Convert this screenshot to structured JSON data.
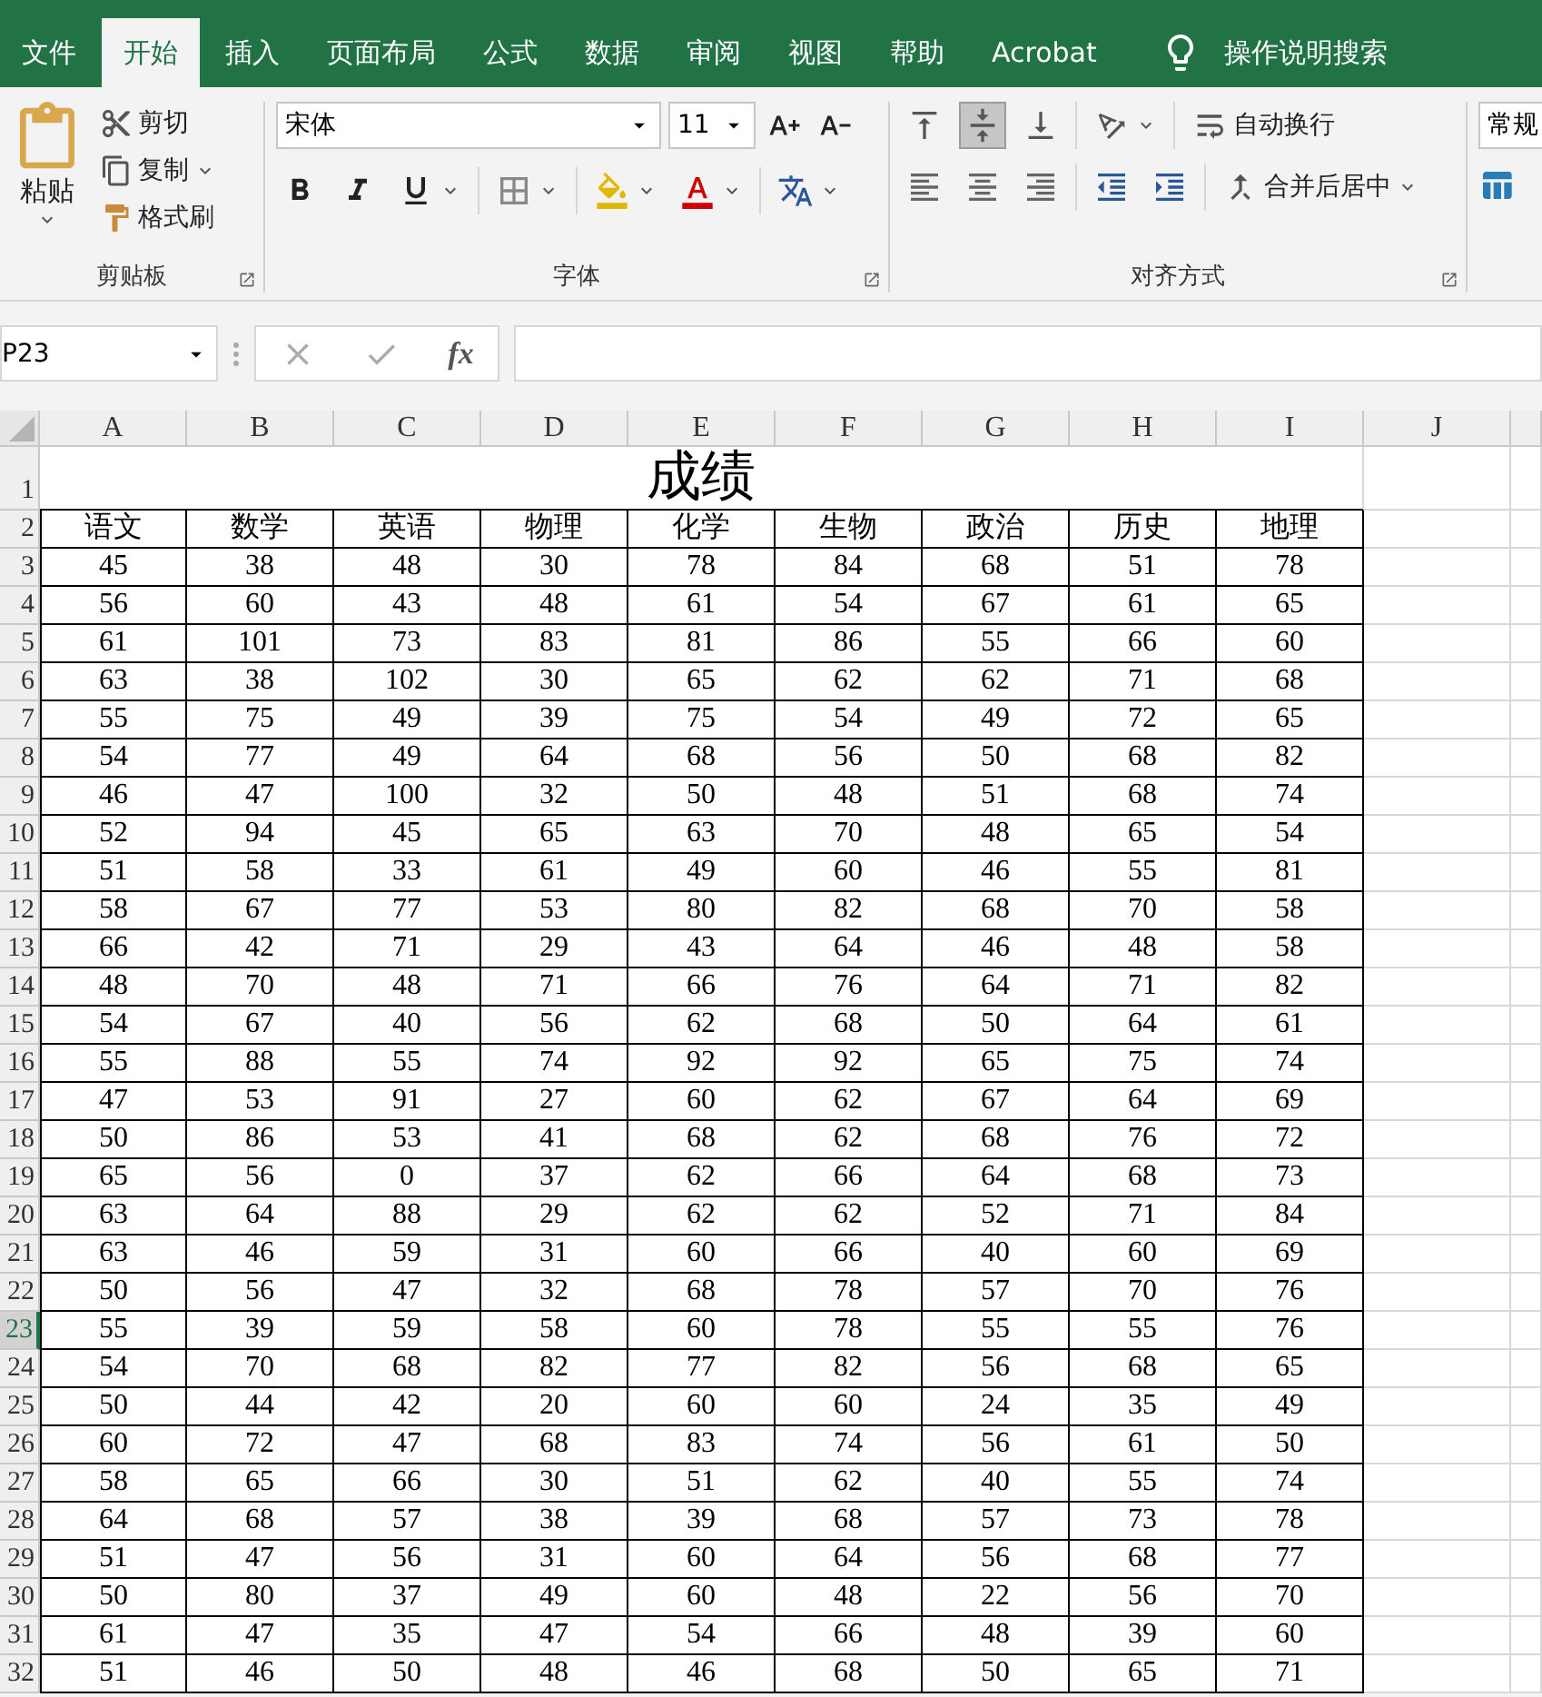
{
  "tabs": [
    {
      "label": "文件",
      "selected": false
    },
    {
      "label": "开始",
      "selected": true
    },
    {
      "label": "插入",
      "selected": false
    },
    {
      "label": "页面布局",
      "selected": false
    },
    {
      "label": "公式",
      "selected": false
    },
    {
      "label": "数据",
      "selected": false
    },
    {
      "label": "审阅",
      "selected": false
    },
    {
      "label": "视图",
      "selected": false
    },
    {
      "label": "帮助",
      "selected": false
    },
    {
      "label": "Acrobat",
      "selected": false
    }
  ],
  "tell_me": {
    "label": "操作说明搜索"
  },
  "ribbon": {
    "clipboard": {
      "title": "剪贴板",
      "paste": "粘贴",
      "cut": "剪切",
      "copy": "复制",
      "format_painter": "格式刷"
    },
    "font": {
      "title": "字体",
      "font_name": "宋体",
      "font_size": "11"
    },
    "alignment": {
      "title": "对齐方式",
      "vertical": [
        {
          "kind": "top",
          "selected": false
        },
        {
          "kind": "middle",
          "selected": true
        },
        {
          "kind": "bottom",
          "selected": false
        }
      ],
      "wrap_text": "自动换行",
      "merge_center": "合并后居中"
    },
    "number": {
      "format": "常规"
    }
  },
  "formula_bar": {
    "name_box": "P23",
    "fx": "fx"
  },
  "sheet": {
    "columns": [
      {
        "label": "A",
        "selected": false
      },
      {
        "label": "B",
        "selected": false
      },
      {
        "label": "C",
        "selected": false
      },
      {
        "label": "D",
        "selected": false
      },
      {
        "label": "E",
        "selected": false
      },
      {
        "label": "F",
        "selected": false
      },
      {
        "label": "G",
        "selected": false
      },
      {
        "label": "H",
        "selected": false
      },
      {
        "label": "I",
        "selected": false
      },
      {
        "label": "J",
        "selected": false
      }
    ],
    "title_row": {
      "header": "1",
      "text": "成绩"
    },
    "header_row": {
      "header": "2",
      "cells": [
        "语文",
        "数学",
        "英语",
        "物理",
        "化学",
        "生物",
        "政治",
        "历史",
        "地理"
      ]
    },
    "rows": [
      {
        "header": "3",
        "selected": false,
        "cells": [
          "45",
          "38",
          "48",
          "30",
          "78",
          "84",
          "68",
          "51",
          "78"
        ]
      },
      {
        "header": "4",
        "selected": false,
        "cells": [
          "56",
          "60",
          "43",
          "48",
          "61",
          "54",
          "67",
          "61",
          "65"
        ]
      },
      {
        "header": "5",
        "selected": false,
        "cells": [
          "61",
          "101",
          "73",
          "83",
          "81",
          "86",
          "55",
          "66",
          "60"
        ]
      },
      {
        "header": "6",
        "selected": false,
        "cells": [
          "63",
          "38",
          "102",
          "30",
          "65",
          "62",
          "62",
          "71",
          "68"
        ]
      },
      {
        "header": "7",
        "selected": false,
        "cells": [
          "55",
          "75",
          "49",
          "39",
          "75",
          "54",
          "49",
          "72",
          "65"
        ]
      },
      {
        "header": "8",
        "selected": false,
        "cells": [
          "54",
          "77",
          "49",
          "64",
          "68",
          "56",
          "50",
          "68",
          "82"
        ]
      },
      {
        "header": "9",
        "selected": false,
        "cells": [
          "46",
          "47",
          "100",
          "32",
          "50",
          "48",
          "51",
          "68",
          "74"
        ]
      },
      {
        "header": "10",
        "selected": false,
        "cells": [
          "52",
          "94",
          "45",
          "65",
          "63",
          "70",
          "48",
          "65",
          "54"
        ]
      },
      {
        "header": "11",
        "selected": false,
        "cells": [
          "51",
          "58",
          "33",
          "61",
          "49",
          "60",
          "46",
          "55",
          "81"
        ]
      },
      {
        "header": "12",
        "selected": false,
        "cells": [
          "58",
          "67",
          "77",
          "53",
          "80",
          "82",
          "68",
          "70",
          "58"
        ]
      },
      {
        "header": "13",
        "selected": false,
        "cells": [
          "66",
          "42",
          "71",
          "29",
          "43",
          "64",
          "46",
          "48",
          "58"
        ]
      },
      {
        "header": "14",
        "selected": false,
        "cells": [
          "48",
          "70",
          "48",
          "71",
          "66",
          "76",
          "64",
          "71",
          "82"
        ]
      },
      {
        "header": "15",
        "selected": false,
        "cells": [
          "54",
          "67",
          "40",
          "56",
          "62",
          "68",
          "50",
          "64",
          "61"
        ]
      },
      {
        "header": "16",
        "selected": false,
        "cells": [
          "55",
          "88",
          "55",
          "74",
          "92",
          "92",
          "65",
          "75",
          "74"
        ]
      },
      {
        "header": "17",
        "selected": false,
        "cells": [
          "47",
          "53",
          "91",
          "27",
          "60",
          "62",
          "67",
          "64",
          "69"
        ]
      },
      {
        "header": "18",
        "selected": false,
        "cells": [
          "50",
          "86",
          "53",
          "41",
          "68",
          "62",
          "68",
          "76",
          "72"
        ]
      },
      {
        "header": "19",
        "selected": false,
        "cells": [
          "65",
          "56",
          "0",
          "37",
          "62",
          "66",
          "64",
          "68",
          "73"
        ]
      },
      {
        "header": "20",
        "selected": false,
        "cells": [
          "63",
          "64",
          "88",
          "29",
          "62",
          "62",
          "52",
          "71",
          "84"
        ]
      },
      {
        "header": "21",
        "selected": false,
        "cells": [
          "63",
          "46",
          "59",
          "31",
          "60",
          "66",
          "40",
          "60",
          "69"
        ]
      },
      {
        "header": "22",
        "selected": false,
        "cells": [
          "50",
          "56",
          "47",
          "32",
          "68",
          "78",
          "57",
          "70",
          "76"
        ]
      },
      {
        "header": "23",
        "selected": true,
        "cells": [
          "55",
          "39",
          "59",
          "58",
          "60",
          "78",
          "55",
          "55",
          "76"
        ]
      },
      {
        "header": "24",
        "selected": false,
        "cells": [
          "54",
          "70",
          "68",
          "82",
          "77",
          "82",
          "56",
          "68",
          "65"
        ]
      },
      {
        "header": "25",
        "selected": false,
        "cells": [
          "50",
          "44",
          "42",
          "20",
          "60",
          "60",
          "24",
          "35",
          "49"
        ]
      },
      {
        "header": "26",
        "selected": false,
        "cells": [
          "60",
          "72",
          "47",
          "68",
          "83",
          "74",
          "56",
          "61",
          "50"
        ]
      },
      {
        "header": "27",
        "selected": false,
        "cells": [
          "58",
          "65",
          "66",
          "30",
          "51",
          "62",
          "40",
          "55",
          "74"
        ]
      },
      {
        "header": "28",
        "selected": false,
        "cells": [
          "64",
          "68",
          "57",
          "38",
          "39",
          "68",
          "57",
          "73",
          "78"
        ]
      },
      {
        "header": "29",
        "selected": false,
        "cells": [
          "51",
          "47",
          "56",
          "31",
          "60",
          "64",
          "56",
          "68",
          "77"
        ]
      },
      {
        "header": "30",
        "selected": false,
        "cells": [
          "50",
          "80",
          "37",
          "49",
          "60",
          "48",
          "22",
          "56",
          "70"
        ]
      },
      {
        "header": "31",
        "selected": false,
        "cells": [
          "61",
          "47",
          "35",
          "47",
          "54",
          "66",
          "48",
          "39",
          "60"
        ]
      },
      {
        "header": "32",
        "selected": false,
        "cells": [
          "51",
          "46",
          "50",
          "48",
          "46",
          "68",
          "50",
          "65",
          "71"
        ]
      }
    ]
  }
}
